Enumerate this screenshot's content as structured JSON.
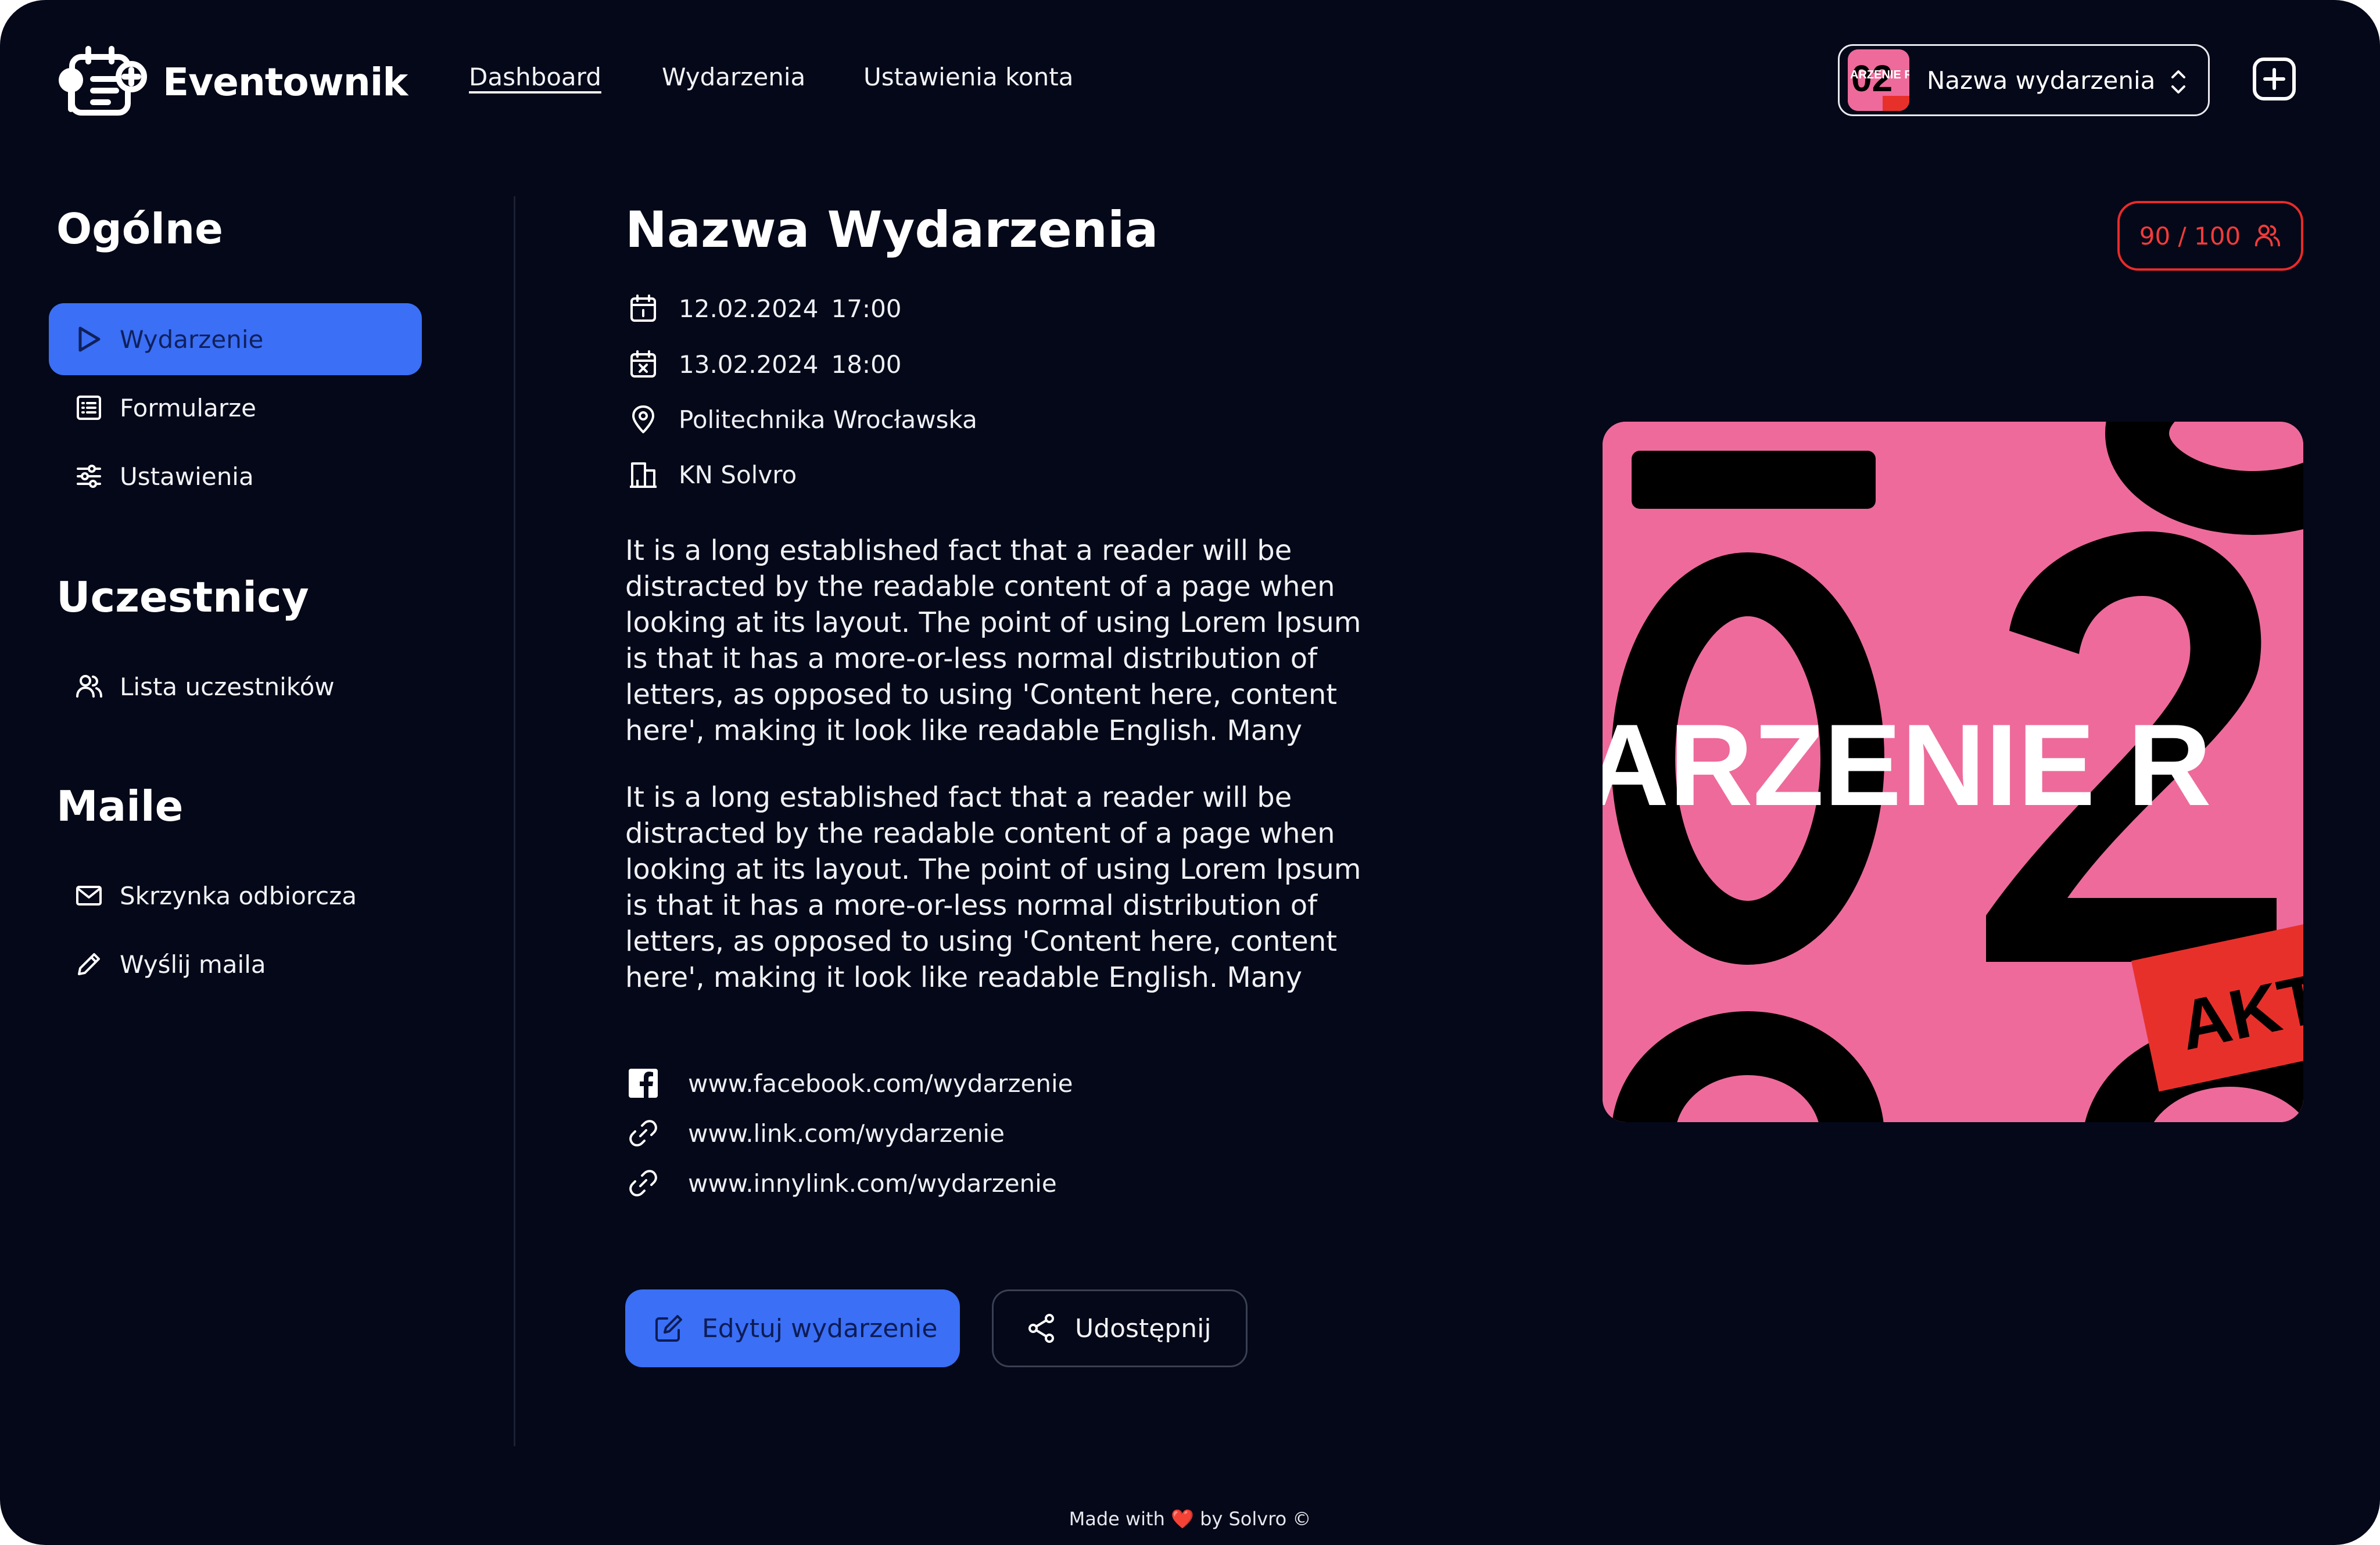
{
  "app": {
    "name": "Eventownik"
  },
  "nav": {
    "links": [
      {
        "label": "Dashboard",
        "active": true
      },
      {
        "label": "Wydarzenia",
        "active": false
      },
      {
        "label": "Ustawienia konta",
        "active": false
      }
    ]
  },
  "event_select": {
    "label": "Nazwa wydarzenia",
    "thumb_text": "ARZENIE R"
  },
  "sidebar": {
    "sections": [
      {
        "title": "Ogólne",
        "items": [
          {
            "label": "Wydarzenie",
            "icon": "play-icon",
            "active": true
          },
          {
            "label": "Formularze",
            "icon": "form-list-icon",
            "active": false
          },
          {
            "label": "Ustawienia",
            "icon": "sliders-icon",
            "active": false
          }
        ]
      },
      {
        "title": "Uczestnicy",
        "items": [
          {
            "label": "Lista uczestników",
            "icon": "users-icon",
            "active": false
          }
        ]
      },
      {
        "title": "Maile",
        "items": [
          {
            "label": "Skrzynka odbiorcza",
            "icon": "mail-icon",
            "active": false
          },
          {
            "label": "Wyślij maila",
            "icon": "pencil-icon",
            "active": false
          }
        ]
      }
    ]
  },
  "event": {
    "title": "Nazwa Wydarzenia",
    "start_date": "12.02.2024",
    "start_time": "17:00",
    "end_date": "13.02.2024",
    "end_time": "18:00",
    "location": "Politechnika Wrocławska",
    "organizer": "KN Solvro",
    "description": [
      "It is a long established fact that a reader will be distracted by the readable content of a page when looking at its layout. The point of using Lorem Ipsum is that it has a more-or-less normal distribution of letters, as opposed to using 'Content here, content here', making it look like readable English. Many",
      "It is a long established fact that a reader will be distracted by the readable content of a page when looking at its layout. The point of using Lorem Ipsum is that it has a more-or-less normal distribution of letters, as opposed to using 'Content here, content here', making it look like readable English. Many"
    ],
    "links": [
      {
        "url": "www.facebook.com/wydarzenie",
        "icon": "facebook-icon"
      },
      {
        "url": "www.link.com/wydarzenie",
        "icon": "link-icon"
      },
      {
        "url": "www.innylink.com/wydarzenie",
        "icon": "link-icon"
      }
    ],
    "capacity": "90 / 100",
    "poster": {
      "banner_text": "ARZENIE R",
      "tag_text": "AKT"
    }
  },
  "actions": {
    "edit_label": "Edytuj wydarzenie",
    "share_label": "Udostępnij"
  },
  "footer": {
    "prefix": "Made with",
    "heart": "❤️",
    "suffix": "by Solvro ©"
  },
  "colors": {
    "background": "#040818",
    "accent": "#3a6ff6",
    "danger": "#ea2a2a",
    "poster_pink": "#ee6a9b"
  }
}
